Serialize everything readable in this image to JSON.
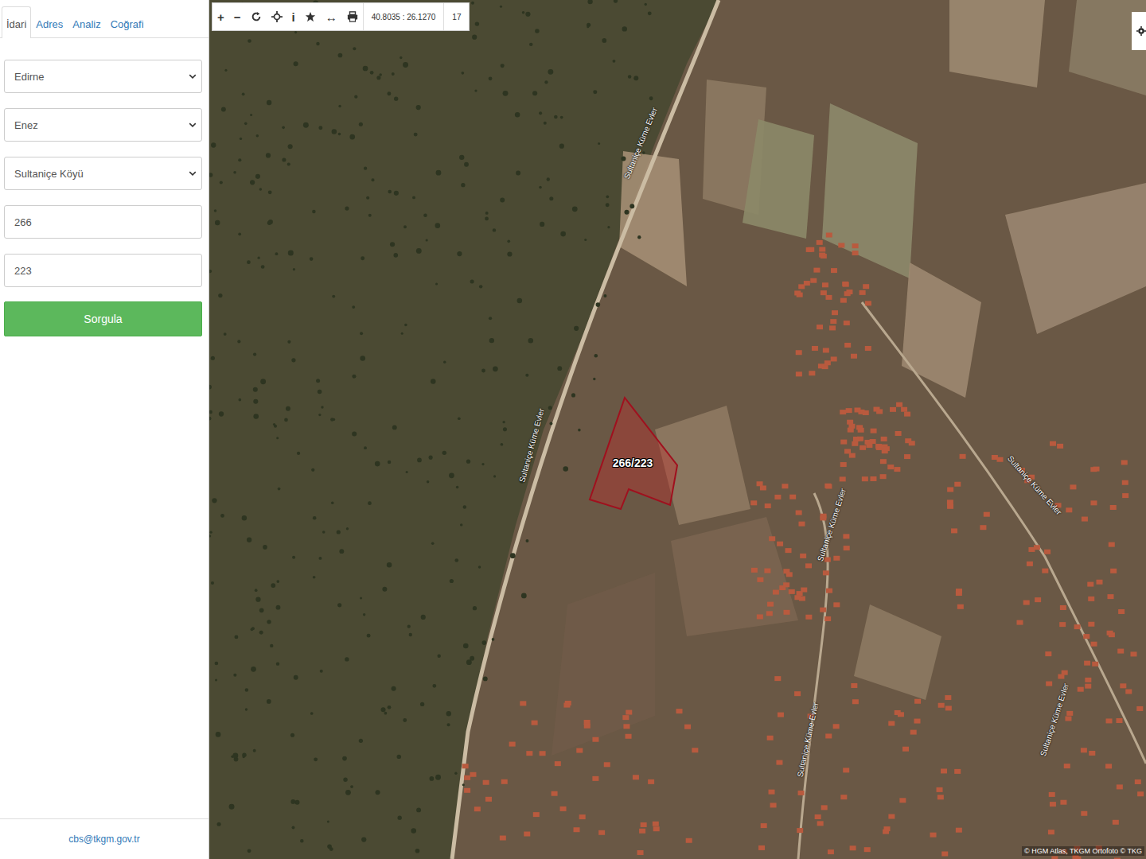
{
  "tabs": [
    {
      "label": "İdari",
      "selected": true
    },
    {
      "label": "Adres",
      "selected": false
    },
    {
      "label": "Analiz",
      "selected": false
    },
    {
      "label": "Coğrafi",
      "selected": false
    }
  ],
  "form": {
    "province": "Edirne",
    "district": "Enez",
    "neighborhood": "Sultaniçe Köyü",
    "block": "266",
    "parcel": "223",
    "submit": "Sorgula"
  },
  "footer": {
    "email": "cbs@tkgm.gov.tr"
  },
  "toolbar": {
    "zoom_in": "+",
    "zoom_out": "−",
    "info": "i",
    "measure": "↔",
    "coordinates": "40.8035 : 26.1270",
    "zoom": "17"
  },
  "map": {
    "parcel_label": "266/223",
    "road_labels": [
      "Sultaniçe Küme Evler",
      "Sultaniçe Küme Evler",
      "Sultaniçe Küme Evler",
      "Sultaniçe Küme Evler",
      "Sultaniçe Küme Evler",
      "Sultaniçe Küme Evler"
    ],
    "attribution": "© HGM Atlas, TKGM Ortofoto © TKG"
  }
}
